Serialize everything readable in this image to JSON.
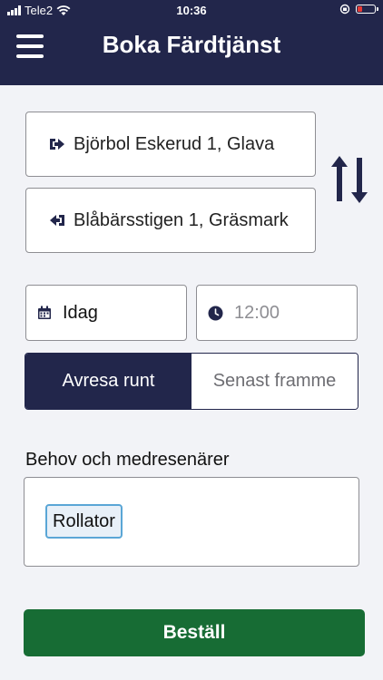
{
  "status_bar": {
    "carrier": "Tele2",
    "time": "10:36",
    "battery_color": "#e53935"
  },
  "header": {
    "title": "Boka Färdtjänst",
    "background": "#22264b"
  },
  "trip": {
    "from_address": "Björbol Eskerud 1, Glava",
    "to_address": "Blåbärsstigen 1, Gräsmark"
  },
  "datetime": {
    "date": "Idag",
    "time_placeholder": "12:00"
  },
  "mode_toggle": {
    "depart": "Avresa runt",
    "arrive": "Senast framme",
    "selected": "depart"
  },
  "needs": {
    "label": "Behov och medresenärer",
    "chips": [
      "Rollator"
    ]
  },
  "order": {
    "label": "Beställ",
    "color": "#176c34"
  },
  "icons": {
    "menu": "hamburger-icon",
    "from": "sign-out-icon",
    "to": "sign-in-icon",
    "swap": "swap-vertical-icon",
    "calendar": "calendar-icon",
    "clock": "clock-icon"
  }
}
